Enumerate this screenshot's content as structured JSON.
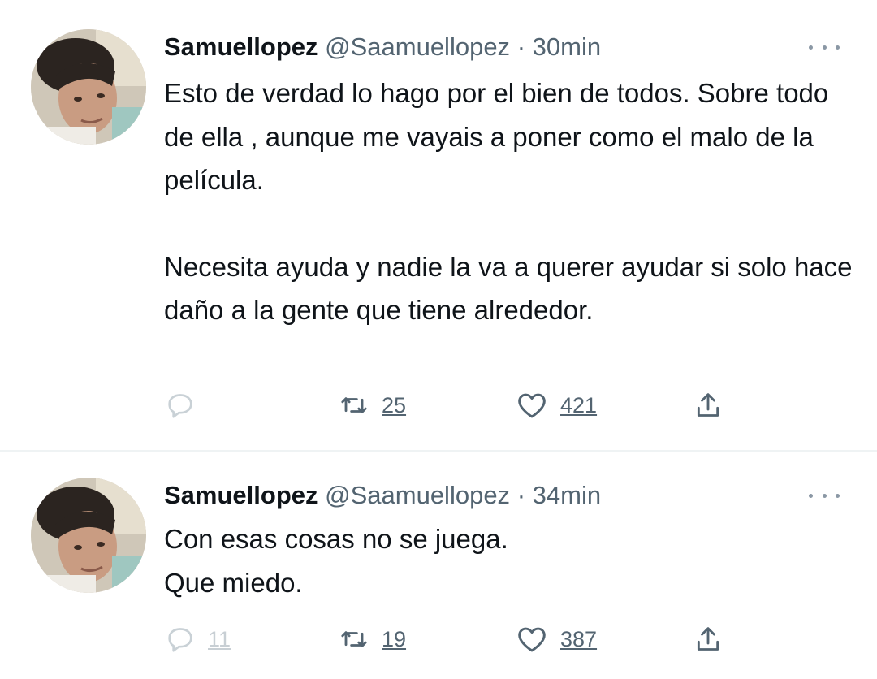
{
  "tweets": [
    {
      "author_name": "Samuellopez",
      "author_handle": "@Saamuellopez",
      "separator": "·",
      "time": "30min",
      "paragraphs": [
        "Esto de verdad lo hago por el bien de todos. Sobre todo de ella , aunque me vayais a poner como el malo de la película.",
        "Necesita ayuda y nadie la va a querer ayudar si solo hace daño a la gente que tiene alrededor."
      ],
      "replies": "",
      "retweets": "25",
      "likes": "421"
    },
    {
      "author_name": "Samuellopez",
      "author_handle": "@Saamuellopez",
      "separator": "·",
      "time": "34min",
      "lines": [
        "Con esas cosas no se juega.",
        "Que miedo."
      ],
      "replies": "11",
      "retweets": "19",
      "likes": "387"
    }
  ],
  "icons": {
    "more": "more-icon",
    "reply": "reply-icon",
    "retweet": "retweet-icon",
    "like": "heart-icon",
    "share": "share-icon"
  },
  "colors": {
    "text": "#0f1419",
    "secondary": "#536471",
    "icon": "#536471",
    "divider": "#eff3f4"
  }
}
